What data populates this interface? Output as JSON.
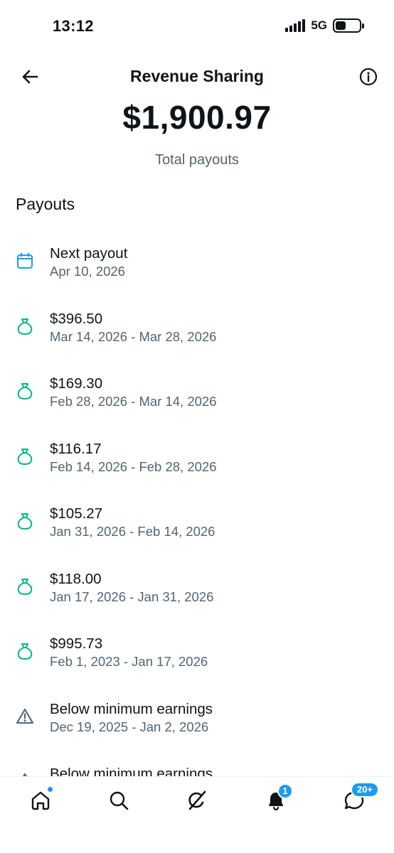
{
  "status_bar": {
    "time": "13:12",
    "network": "5G"
  },
  "header": {
    "title": "Revenue Sharing"
  },
  "summary": {
    "total_amount": "$1,900.97",
    "total_label": "Total payouts"
  },
  "payouts": {
    "section_title": "Payouts",
    "items": [
      {
        "icon": "calendar-icon",
        "title": "Next payout",
        "subtitle": "Apr 10, 2026"
      },
      {
        "icon": "money-bag-icon",
        "title": "$396.50",
        "subtitle": "Mar 14, 2026 - Mar 28, 2026"
      },
      {
        "icon": "money-bag-icon",
        "title": "$169.30",
        "subtitle": "Feb 28, 2026 - Mar 14, 2026"
      },
      {
        "icon": "money-bag-icon",
        "title": "$116.17",
        "subtitle": "Feb 14, 2026 - Feb 28, 2026"
      },
      {
        "icon": "money-bag-icon",
        "title": "$105.27",
        "subtitle": "Jan 31, 2026 - Feb 14, 2026"
      },
      {
        "icon": "money-bag-icon",
        "title": "$118.00",
        "subtitle": "Jan 17, 2026 - Jan 31, 2026"
      },
      {
        "icon": "money-bag-icon",
        "title": "$995.73",
        "subtitle": "Feb 1, 2023 - Jan 17, 2026"
      },
      {
        "icon": "warning-icon",
        "title": "Below minimum earnings",
        "subtitle": "Dec 19, 2025 - Jan 2, 2026"
      },
      {
        "icon": "warning-icon",
        "title": "Below minimum earnings",
        "subtitle": ""
      }
    ]
  },
  "bottom_nav": {
    "notifications_badge": "1",
    "messages_badge": "20+"
  },
  "colors": {
    "accent": "#1d9bf0",
    "money_green": "#00ba7c",
    "calendar_blue": "#1d9bf0",
    "secondary_text": "#536471"
  }
}
